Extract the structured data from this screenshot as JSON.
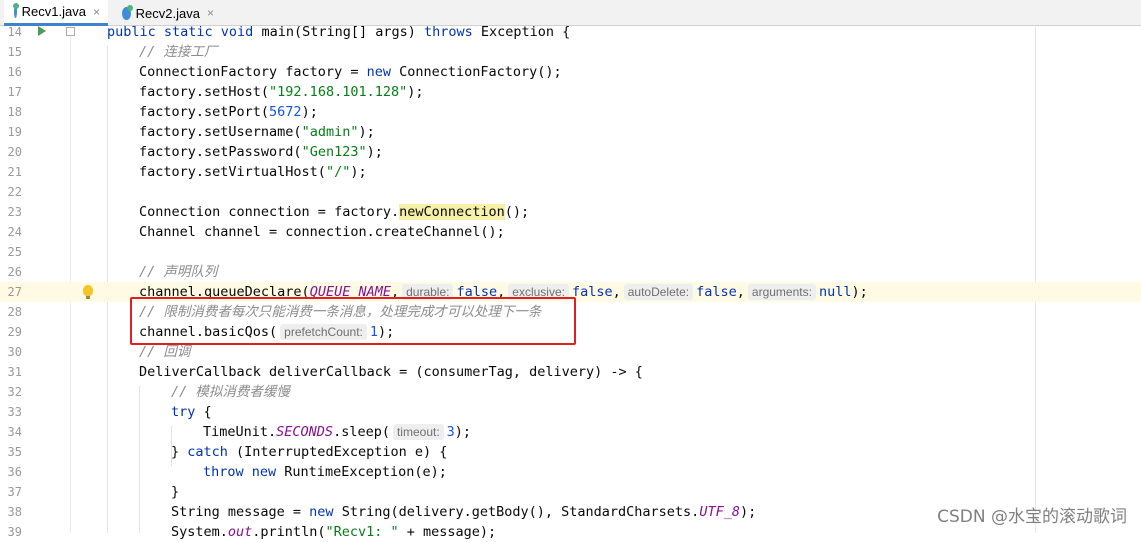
{
  "tabs": [
    {
      "label": "Recv1.java",
      "close": "×",
      "active": true
    },
    {
      "label": "Recv2.java",
      "close": "×",
      "active": false
    }
  ],
  "lines": [
    {
      "n": "14"
    },
    {
      "n": "15"
    },
    {
      "n": "16"
    },
    {
      "n": "17"
    },
    {
      "n": "18"
    },
    {
      "n": "19"
    },
    {
      "n": "20"
    },
    {
      "n": "21"
    },
    {
      "n": "22"
    },
    {
      "n": "23"
    },
    {
      "n": "24"
    },
    {
      "n": "25"
    },
    {
      "n": "26"
    },
    {
      "n": "27"
    },
    {
      "n": "28"
    },
    {
      "n": "29"
    },
    {
      "n": "30"
    },
    {
      "n": "31"
    },
    {
      "n": "32"
    },
    {
      "n": "33"
    },
    {
      "n": "34"
    },
    {
      "n": "35"
    },
    {
      "n": "36"
    },
    {
      "n": "37"
    },
    {
      "n": "38"
    },
    {
      "n": "39"
    }
  ],
  "code": {
    "l14": {
      "kw1": "public static void",
      "t1": " main(String[] args) ",
      "kw2": "throws",
      "t2": " Exception {"
    },
    "l15": {
      "c": "// 连接工厂"
    },
    "l16": {
      "t1": "ConnectionFactory factory = ",
      "kw": "new",
      "t2": " ConnectionFactory();"
    },
    "l17": {
      "t1": "factory.setHost(",
      "s": "\"192.168.101.128\"",
      "t2": ");"
    },
    "l18": {
      "t1": "factory.setPort(",
      "n": "5672",
      "t2": ");"
    },
    "l19": {
      "t1": "factory.setUsername(",
      "s": "\"admin\"",
      "t2": ");"
    },
    "l20": {
      "t1": "factory.setPassword(",
      "s": "\"Gen123\"",
      "t2": ");"
    },
    "l21": {
      "t1": "factory.setVirtualHost(",
      "s": "\"/\"",
      "t2": ");"
    },
    "l23": {
      "t1": "Connection connection = factory.",
      "m": "newConnection",
      "t2": "();"
    },
    "l24": {
      "t1": "Channel channel = connection.createChannel();"
    },
    "l26": {
      "c": "// 声明队列"
    },
    "l27": {
      "t1": "channel.queueDeclare(",
      "sf": "QUEUE_NAME",
      "t2": ",",
      "h1": "durable:",
      "v1": "false",
      "t3": ",",
      "h2": "exclusive:",
      "v2": "false",
      "t4": ",",
      "h3": "autoDelete:",
      "v3": "false",
      "t5": ",",
      "h4": "arguments:",
      "v4": "null",
      "t6": ");"
    },
    "l28": {
      "c": "// 限制消费者每次只能消费一条消息，处理完成才可以处理下一条"
    },
    "l29": {
      "t1": "channel.basicQos(",
      "h": "prefetchCount:",
      "n": "1",
      "t2": ");"
    },
    "l30": {
      "c": "// 回调"
    },
    "l31": {
      "t1": "DeliverCallback deliverCallback = (consumerTag, delivery) -> {"
    },
    "l32": {
      "c": "// 模拟消费者缓慢"
    },
    "l33": {
      "kw": "try",
      "t1": " {"
    },
    "l34": {
      "t1": "TimeUnit.",
      "sf": "SECONDS",
      "t2": ".sleep(",
      "h": "timeout:",
      "n": "3",
      "t3": ");"
    },
    "l35": {
      "t1": "} ",
      "kw": "catch",
      "t2": " (InterruptedException e) {"
    },
    "l36": {
      "kw1": "throw",
      "t1": " ",
      "kw2": "new",
      "t2": " RuntimeException(e);"
    },
    "l37": {
      "t1": "}"
    },
    "l38": {
      "t1": "String message = ",
      "kw": "new",
      "t2": " String(delivery.getBody(), StandardCharsets.",
      "sf": "UTF_8",
      "t3": ");"
    },
    "l39": {
      "t1": "System.",
      "sf": "out",
      "t2": ".println(",
      "s": "\"Recv1: \"",
      "t3": " + message);"
    }
  },
  "watermark": "CSDN @水宝的滚动歌词",
  "colors": {
    "keyword": "#0033b3",
    "string": "#067d17",
    "number": "#1750eb",
    "comment": "#8c8c8c",
    "static_field": "#871094",
    "annotation_box": "#e02020"
  }
}
